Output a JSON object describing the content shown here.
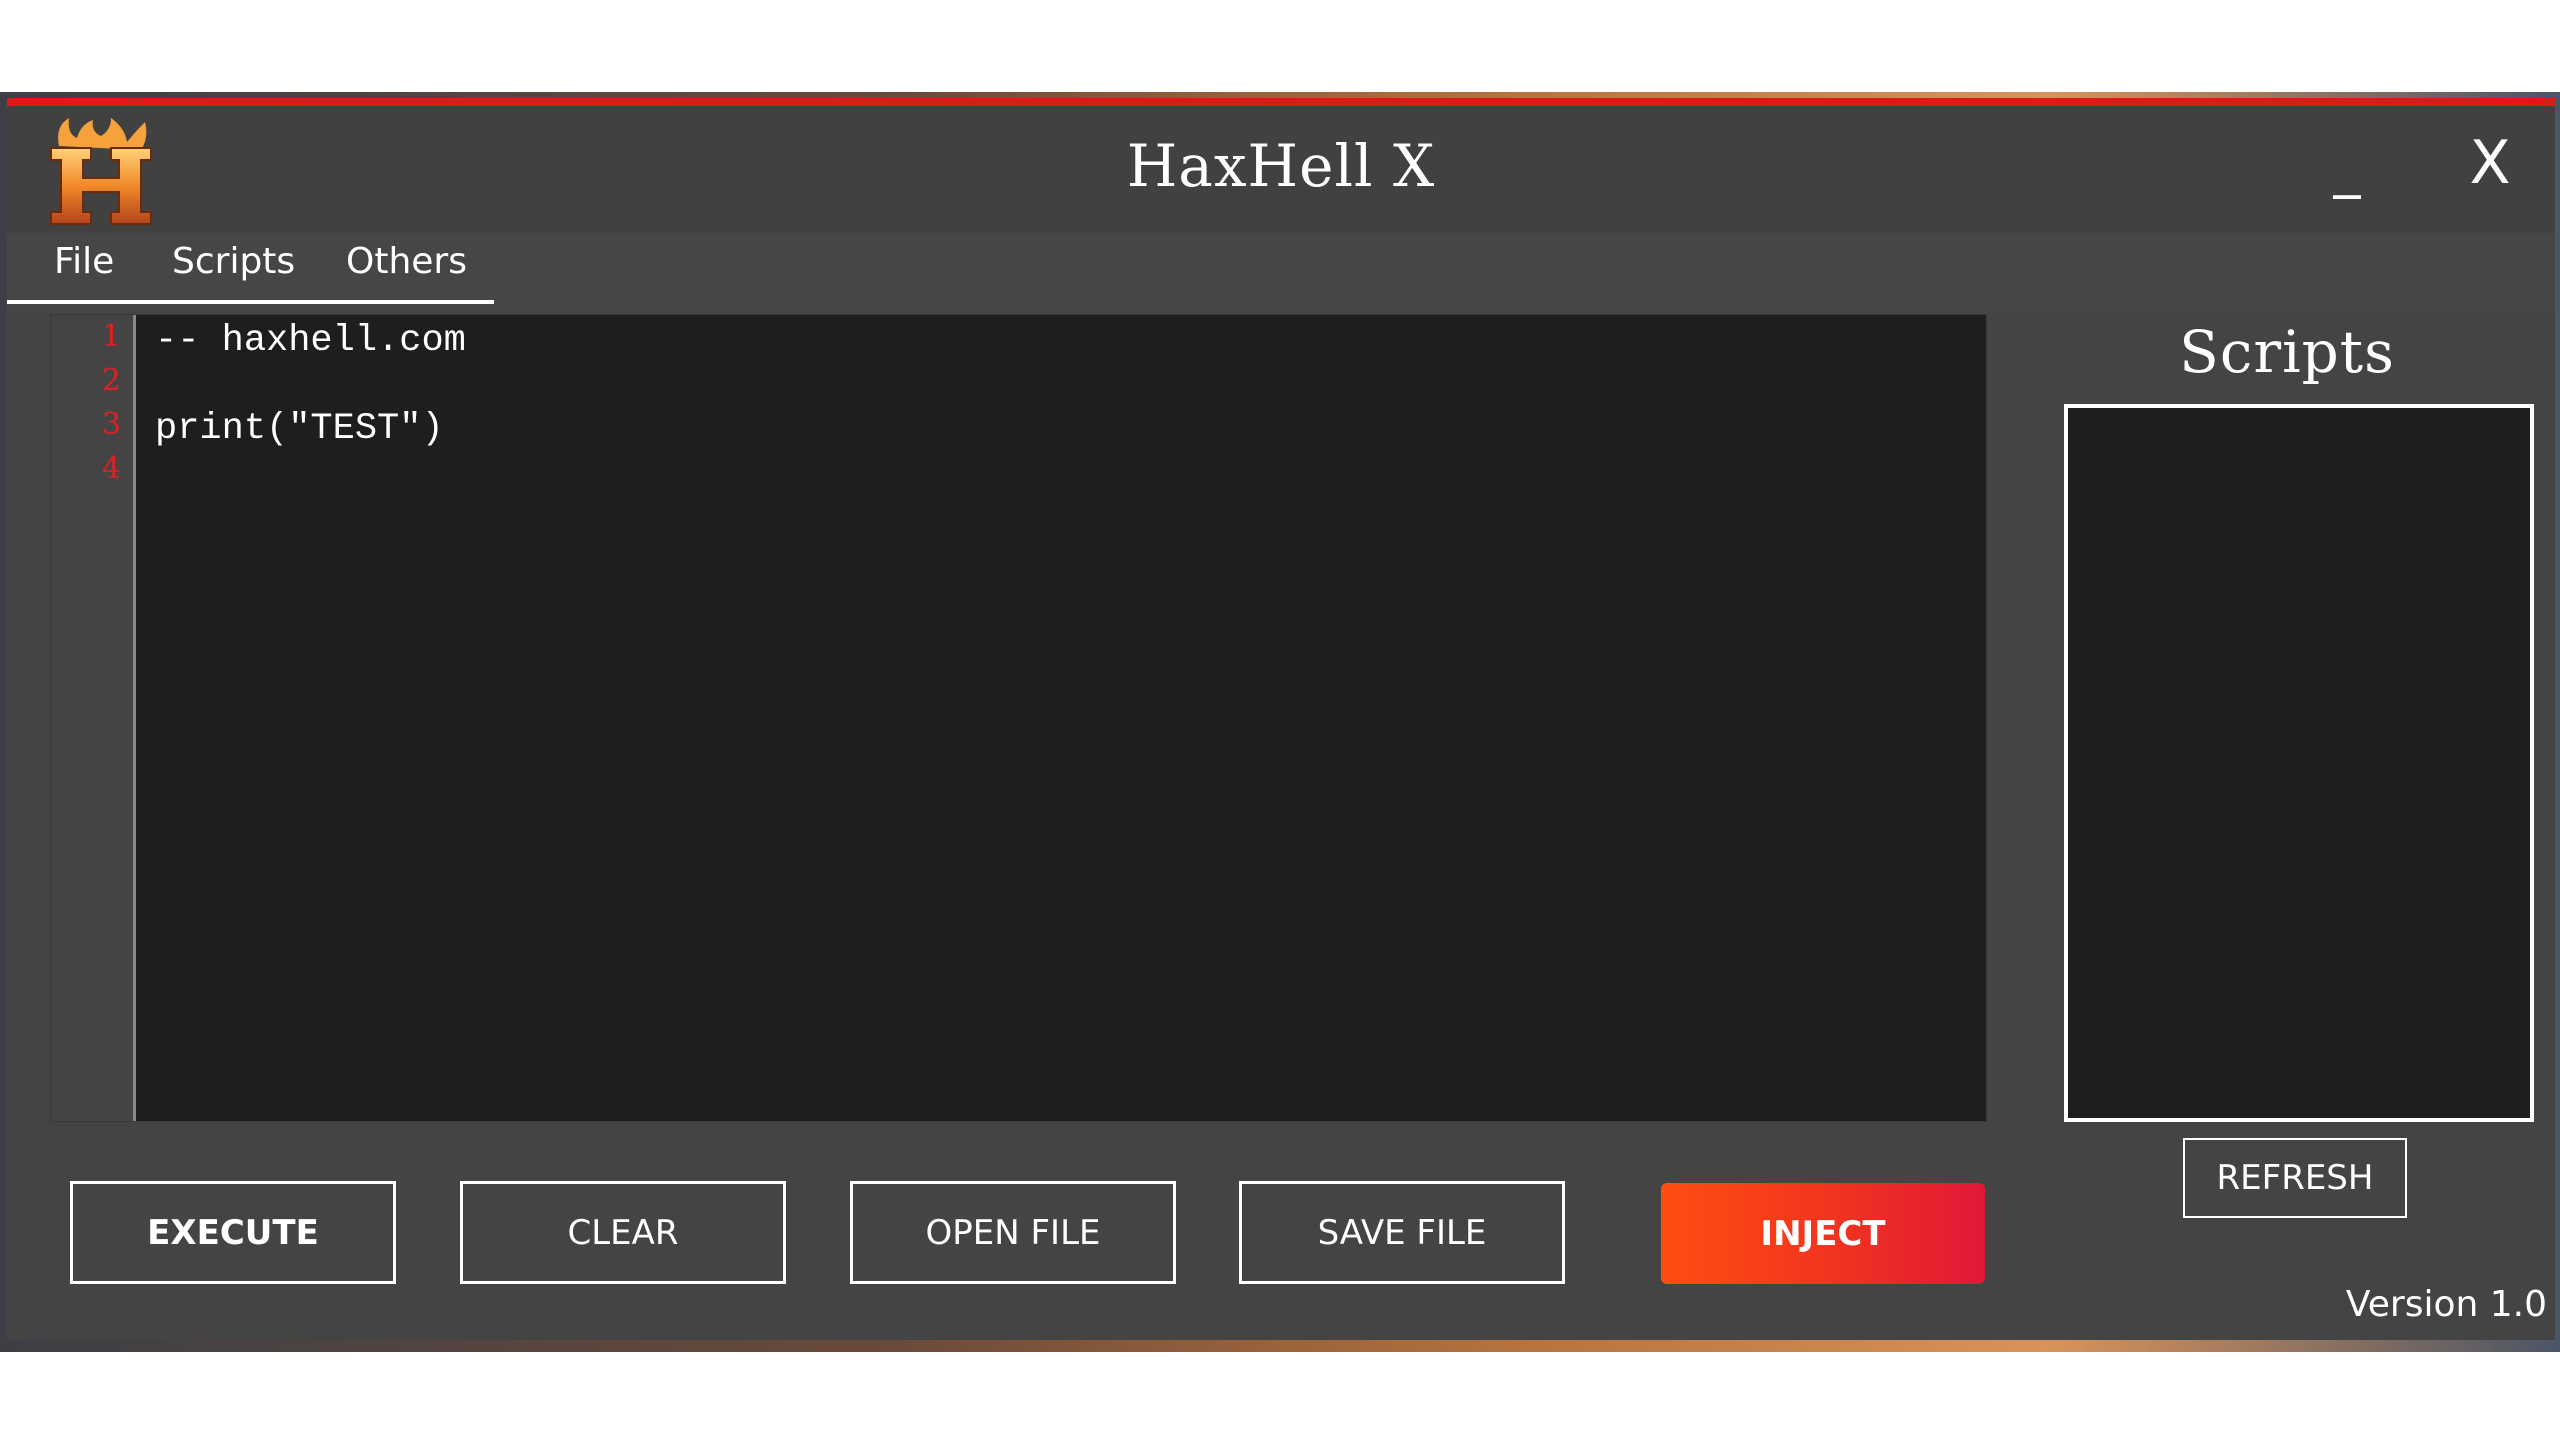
{
  "window": {
    "title": "HaxHell X",
    "minimize_label": "_",
    "close_label": "X",
    "accent": "#e01818",
    "logo_letter": "H"
  },
  "menu": {
    "items": [
      {
        "label": "File"
      },
      {
        "label": "Scripts"
      },
      {
        "label": "Others"
      }
    ]
  },
  "editor": {
    "line_numbers": [
      "1",
      "2",
      "3",
      "4"
    ],
    "lines": [
      "-- haxhell.com",
      "",
      "print(\"TEST\")",
      ""
    ]
  },
  "sidebar": {
    "title": "Scripts",
    "refresh_label": "REFRESH"
  },
  "toolbar": {
    "execute_label": "EXECUTE",
    "clear_label": "CLEAR",
    "open_label": "OPEN FILE",
    "save_label": "SAVE FILE",
    "inject_label": "INJECT"
  },
  "footer": {
    "version": "Version 1.0"
  }
}
